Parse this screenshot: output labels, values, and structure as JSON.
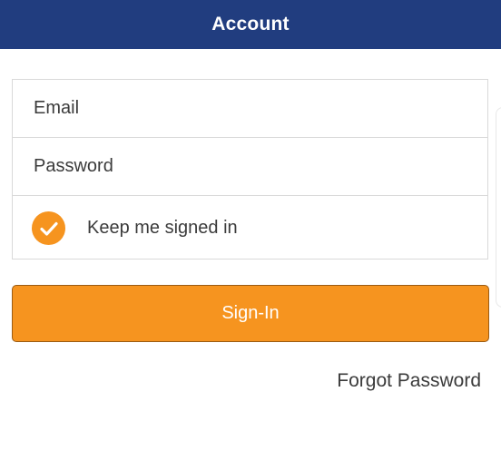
{
  "header": {
    "title": "Account"
  },
  "login_form": {
    "email_placeholder": "Email",
    "password_placeholder": "Password",
    "remember_label": "Keep me signed in",
    "remember_checked": true,
    "signin_label": "Sign-In",
    "forgot_password_label": "Forgot Password"
  },
  "colors": {
    "header": "#213d7f",
    "accent": "#f6941f",
    "text": "#3b3b3b"
  },
  "icons": {
    "checkbox": "check-icon"
  }
}
